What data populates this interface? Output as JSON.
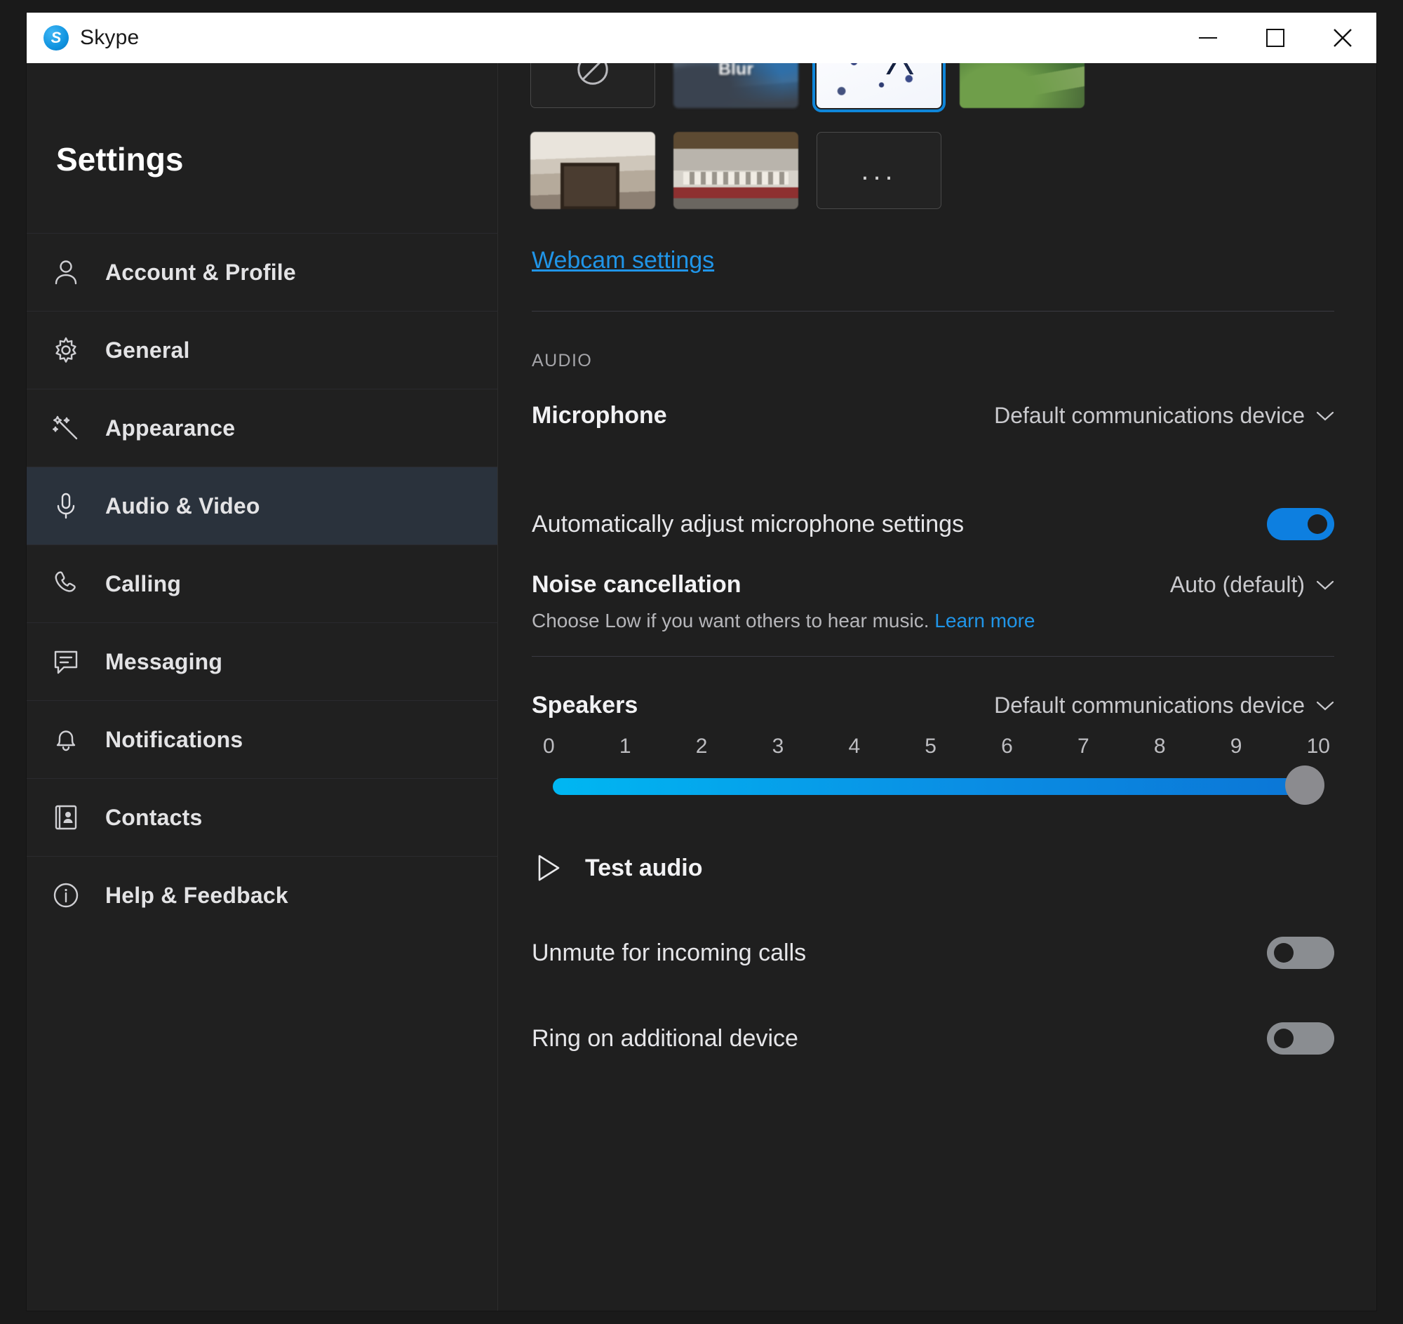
{
  "window": {
    "app_title": "Skype",
    "logo_letter": "S",
    "controls": {
      "minimize": "minimize-button",
      "maximize": "maximize-button",
      "close": "close-button"
    }
  },
  "sidebar": {
    "heading": "Settings",
    "items": [
      {
        "label": "Account & Profile",
        "icon": "person-icon",
        "selected": false
      },
      {
        "label": "General",
        "icon": "gear-icon",
        "selected": false
      },
      {
        "label": "Appearance",
        "icon": "magic-wand-icon",
        "selected": false
      },
      {
        "label": "Audio & Video",
        "icon": "microphone-icon",
        "selected": true
      },
      {
        "label": "Calling",
        "icon": "phone-icon",
        "selected": false
      },
      {
        "label": "Messaging",
        "icon": "chat-bubble-icon",
        "selected": false
      },
      {
        "label": "Notifications",
        "icon": "bell-icon",
        "selected": false
      },
      {
        "label": "Contacts",
        "icon": "address-book-icon",
        "selected": false
      },
      {
        "label": "Help & Feedback",
        "icon": "info-circle-icon",
        "selected": false
      }
    ]
  },
  "main": {
    "backgrounds": {
      "row1": [
        {
          "name": "no-background",
          "label": "",
          "icon": "no-background-icon",
          "selected": false
        },
        {
          "name": "blur",
          "label": "Blur",
          "selected": false
        },
        {
          "name": "white-pattern",
          "label": "",
          "selected": true
        },
        {
          "name": "green-outdoor",
          "label": "",
          "selected": false
        }
      ],
      "row2": [
        {
          "name": "room-photo",
          "label": "",
          "selected": false
        },
        {
          "name": "shop-photo",
          "label": "",
          "selected": false
        },
        {
          "name": "more-backgrounds",
          "label": "...",
          "selected": false
        }
      ]
    },
    "webcam_settings_link": "Webcam settings",
    "audio_section_label": "AUDIO",
    "microphone": {
      "label": "Microphone",
      "value": "Default communications device"
    },
    "auto_adjust": {
      "label": "Automatically adjust microphone settings",
      "state": "on"
    },
    "noise_cancellation": {
      "label": "Noise cancellation",
      "value": "Auto (default)",
      "hint_text": "Choose Low if you want others to hear music.",
      "hint_link": "Learn more"
    },
    "speakers": {
      "label": "Speakers",
      "value": "Default communications device",
      "ticks": [
        "0",
        "1",
        "2",
        "3",
        "4",
        "5",
        "6",
        "7",
        "8",
        "9",
        "10"
      ],
      "volume": 10,
      "min": 0,
      "max": 10
    },
    "test_audio": {
      "label": "Test audio",
      "icon": "play-icon"
    },
    "unmute_incoming": {
      "label": "Unmute for incoming calls",
      "state": "off"
    },
    "ring_additional": {
      "label": "Ring on additional device",
      "state": "off"
    }
  },
  "colors": {
    "accent_blue": "#0f86d9",
    "link_blue": "#2095e8",
    "toggle_on": "#0d7fe0",
    "toggle_off": "#8a8d91",
    "panel_bg": "#1f1f1f",
    "sidebar_bg": "#202020",
    "selected_nav_bg": "#2a323c"
  }
}
